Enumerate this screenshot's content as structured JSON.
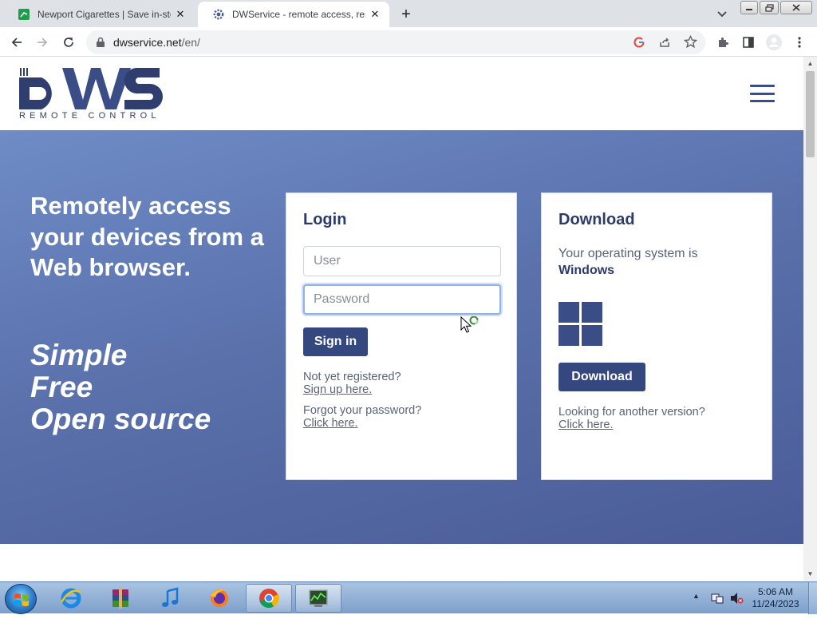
{
  "browser": {
    "tabs": [
      {
        "title": "Newport Cigarettes | Save in-sto",
        "favicon": "newport-favicon",
        "active": false
      },
      {
        "title": "DWService - remote access, rem",
        "favicon": "dwservice-gear-favicon",
        "active": true
      }
    ],
    "url_domain": "dwservice.net",
    "url_path": "/en/"
  },
  "site": {
    "logo_text": "DWS",
    "logo_subtitle": "REMOTE CONTROL",
    "hero": {
      "title": "Remotely access your devices from a Web browser.",
      "taglines": [
        "Simple",
        "Free",
        "Open source"
      ]
    },
    "login": {
      "title": "Login",
      "user_placeholder": "User",
      "password_placeholder": "Password",
      "signin_label": "Sign in",
      "register_prompt": "Not yet registered?",
      "register_link": "Sign up here.",
      "forgot_prompt": "Forgot your password?",
      "forgot_link": "Click here."
    },
    "download": {
      "title": "Download",
      "os_prefix": "Your operating system is",
      "os_name": "Windows",
      "button_label": "Download",
      "other_prompt": "Looking for another version?",
      "other_link": "Click here."
    }
  },
  "taskbar": {
    "apps": [
      "internet-explorer",
      "winrar",
      "itunes",
      "firefox",
      "chrome",
      "task-manager"
    ],
    "time": "5:06 AM",
    "date": "11/24/2023"
  },
  "colors": {
    "brand_navy": "#35477f",
    "hero_start": "#6f8cc7",
    "hero_end": "#4a5c97"
  }
}
